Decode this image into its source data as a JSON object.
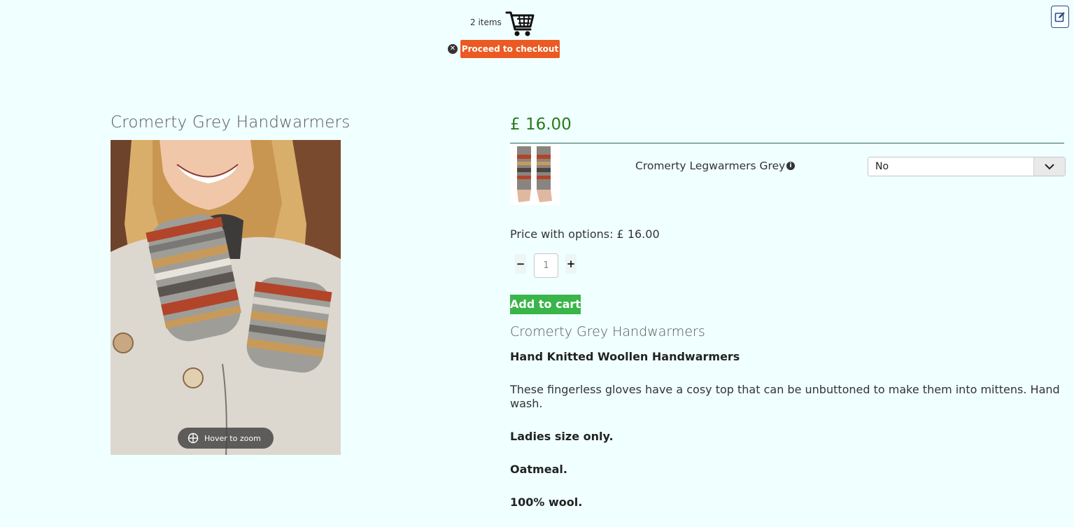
{
  "cart": {
    "count_label": "2 items",
    "checkout_label": "Proceed to checkout",
    "clear_glyph": "✕"
  },
  "product": {
    "title": "Cromerty Grey Handwarmers",
    "zoom_hint": "Hover to zoom",
    "price": "£ 16.00",
    "option": {
      "name": "Cromerty Legwarmers Grey",
      "selected": "No"
    },
    "price_with_options": "Price with options: £ 16.00",
    "quantity": "1",
    "qty_minus": "−",
    "qty_plus": "+",
    "add_to_cart": "Add to cart"
  },
  "description": {
    "title": "Cromerty Grey Handwarmers",
    "subtitle": "Hand Knitted Woollen Handwarmers",
    "body": "These fingerless gloves have a cosy top that can be unbuttoned to make them into mittens.  Hand wash.",
    "size": "Ladies size only.",
    "colour": "Oatmeal.",
    "material": "100% wool."
  },
  "colors": {
    "background": "#f0ffff",
    "price": "#2a7a18",
    "checkout": "#ea5a22",
    "add_to_cart": "#3ab54a"
  },
  "icons": [
    "cart-icon",
    "close-circle-icon",
    "edit-icon",
    "zoom-icon",
    "info-icon",
    "chevron-down-icon"
  ]
}
